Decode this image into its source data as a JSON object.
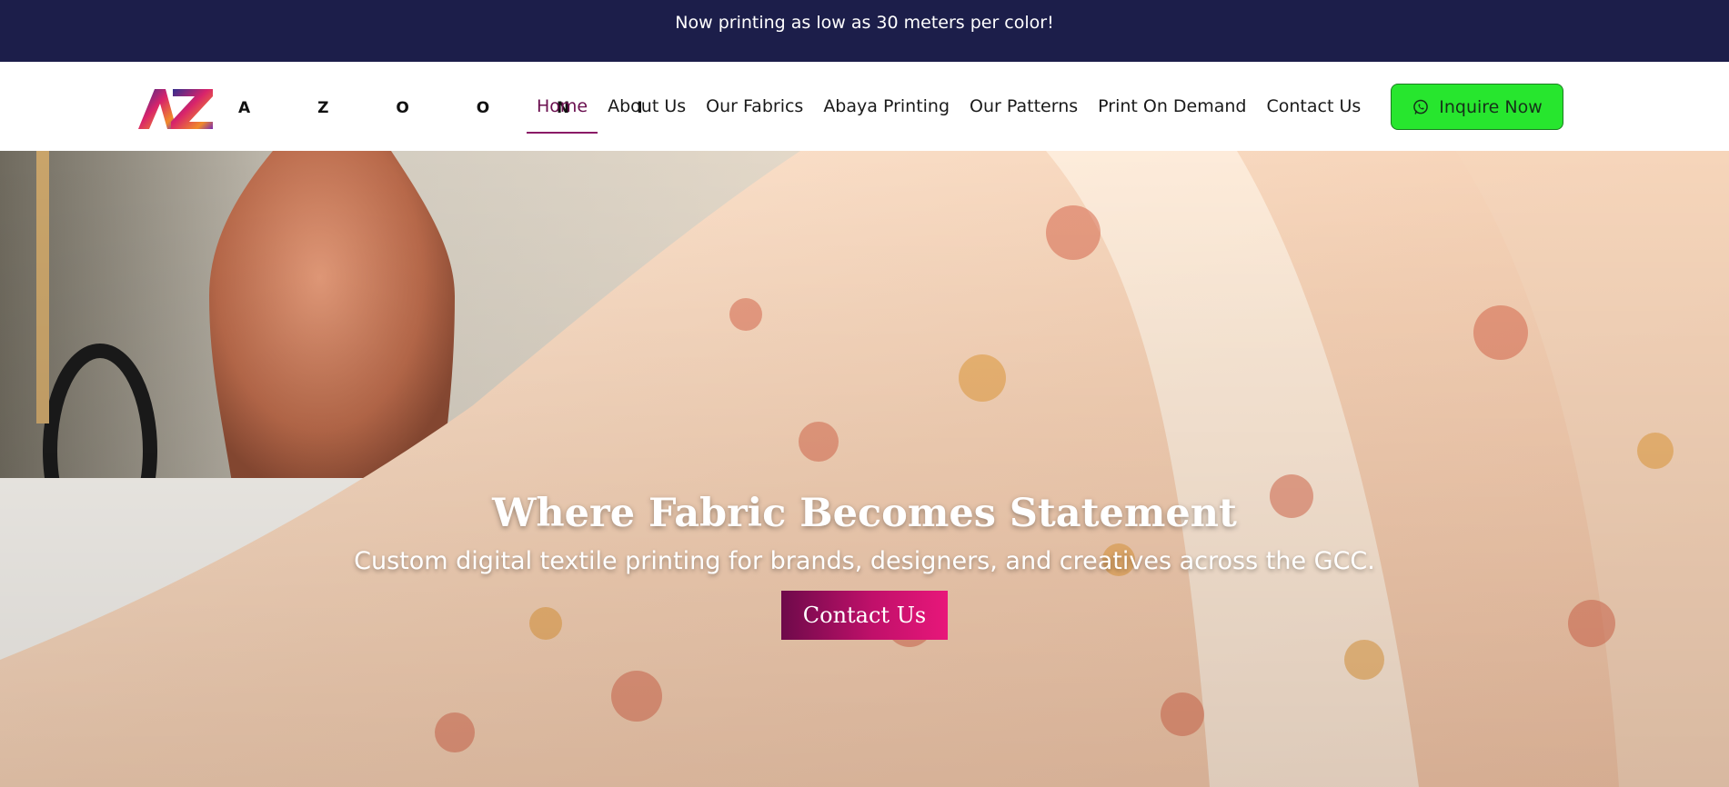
{
  "announcement": {
    "text": "Now printing as low as 30 meters per color!"
  },
  "brand": {
    "mark": "AZ",
    "name": "A Z O O N I"
  },
  "nav": {
    "items": [
      {
        "label": "Home",
        "active": true
      },
      {
        "label": "About Us"
      },
      {
        "label": "Our Fabrics"
      },
      {
        "label": "Abaya Printing"
      },
      {
        "label": "Our Patterns"
      },
      {
        "label": "Print On Demand"
      },
      {
        "label": "Contact Us"
      }
    ]
  },
  "cta": {
    "label": "Inquire Now",
    "icon": "whatsapp-icon",
    "color": "#27e62e"
  },
  "hero": {
    "title": "Where Fabric Becomes Statement",
    "subtitle": "Custom digital textile printing for brands, designers, and creatives across the GCC.",
    "button_label": "Contact Us",
    "background": "floral-printed-fabric-photo"
  },
  "colors": {
    "announce_bg": "#1c1e4a",
    "active_nav": "#6a0f4f",
    "cta_gradient_start": "#6e0a4a",
    "cta_gradient_end": "#e8177a"
  }
}
